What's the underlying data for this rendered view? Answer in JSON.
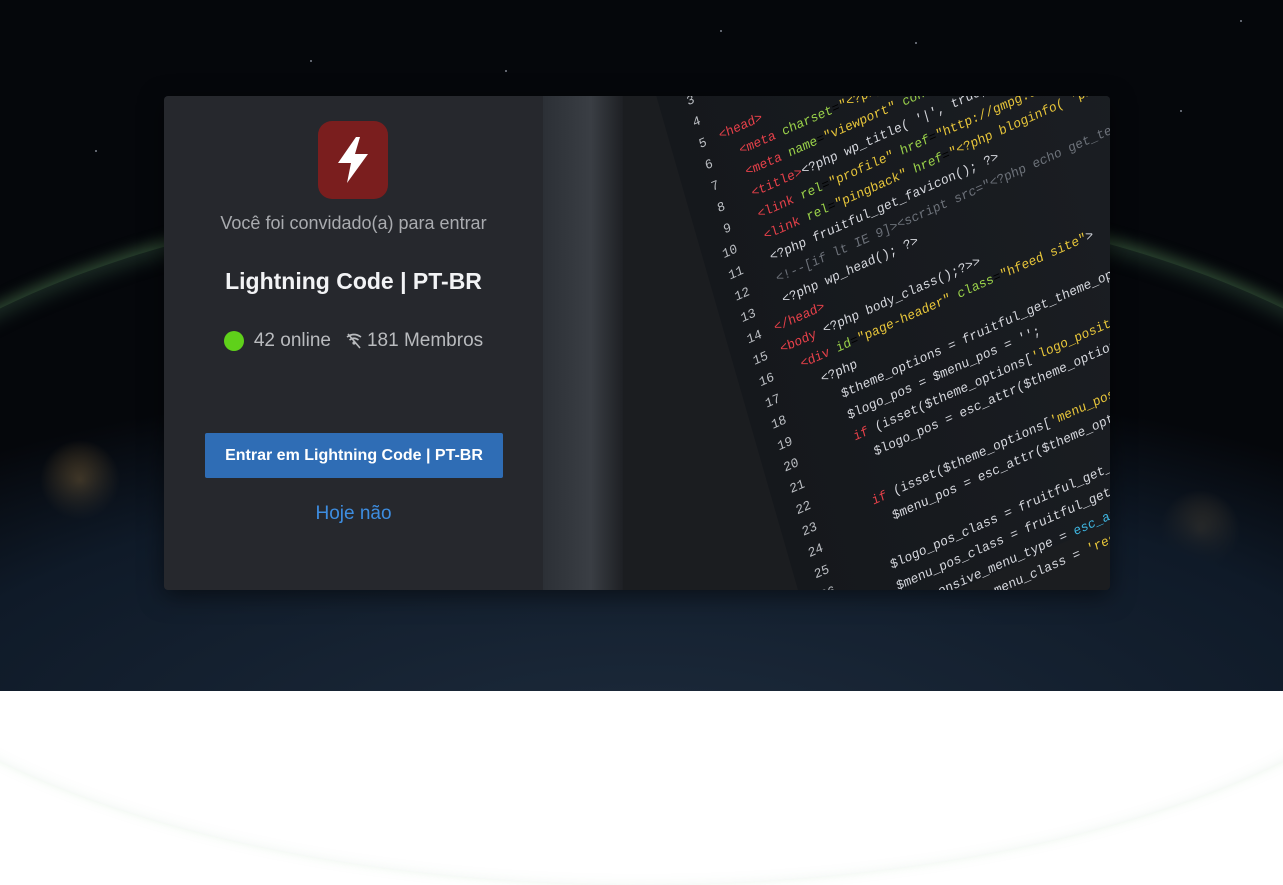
{
  "invite": {
    "prompt": "Você foi convidado(a) para entrar",
    "server_name": "Lightning Code | PT-BR",
    "online_count": "42 online",
    "member_count": "181 Membros",
    "join_button": "Entrar em Lightning Code | PT-BR",
    "decline_link": "Hoje não"
  },
  "icons": {
    "server": "lightning-bolt-icon",
    "online": "online-status-dot",
    "members": "members-icon"
  },
  "colors": {
    "server_icon_bg": "#7a1e1e",
    "online_green": "#5fd11a",
    "button_blue": "#2f6db5",
    "link_blue": "#3d8de0",
    "panel_bg": "#26282d"
  }
}
